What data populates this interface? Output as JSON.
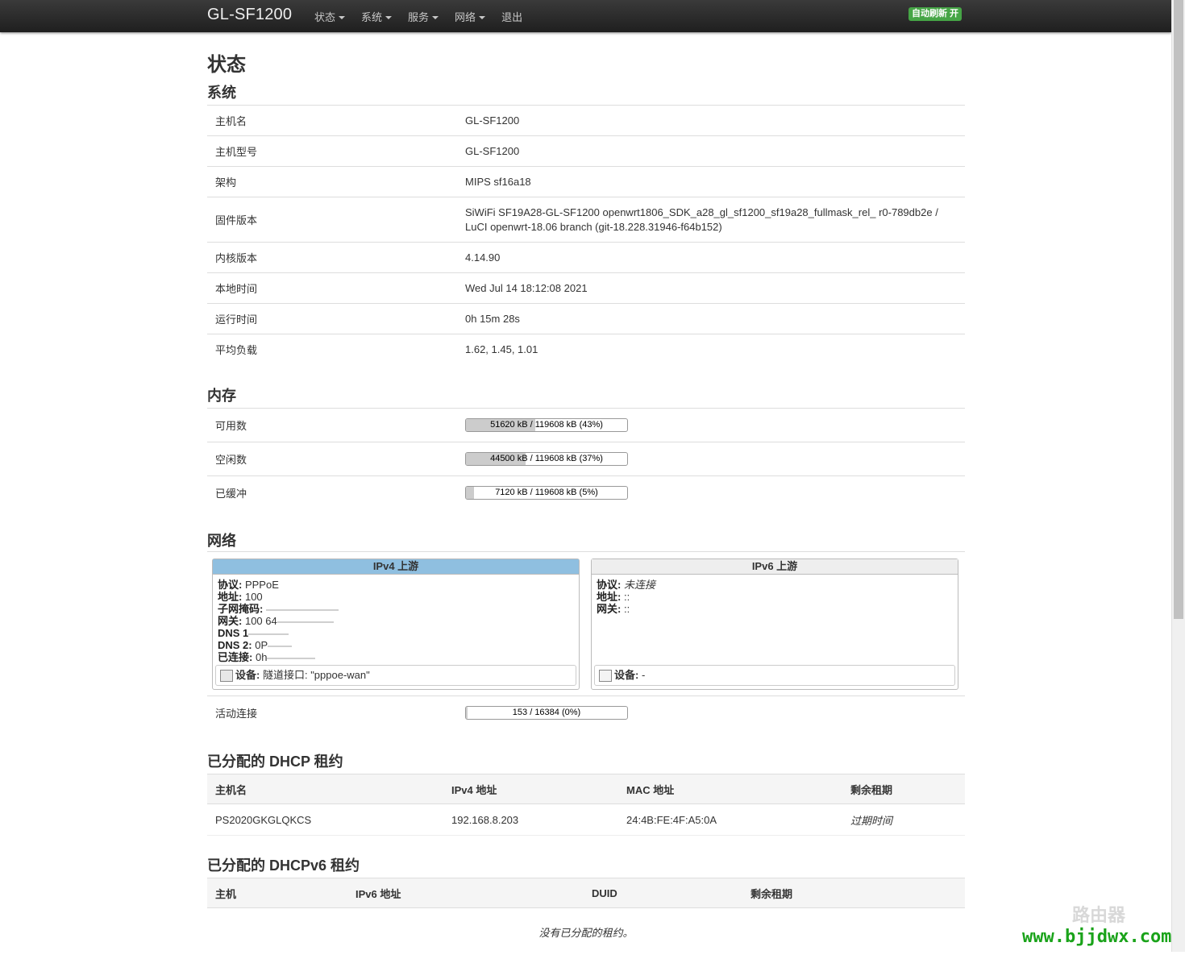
{
  "nav": {
    "brand": "GL-SF1200",
    "menu": [
      "状态",
      "系统",
      "服务",
      "网络",
      "退出"
    ],
    "autorefresh": "自动刷新 开"
  },
  "page_title": "状态",
  "system": {
    "heading": "系统",
    "rows": [
      {
        "k": "主机名",
        "v": "GL-SF1200"
      },
      {
        "k": "主机型号",
        "v": "GL-SF1200"
      },
      {
        "k": "架构",
        "v": "MIPS sf16a18"
      },
      {
        "k": "固件版本",
        "v": "SiWiFi SF19A28-GL-SF1200 openwrt1806_SDK_a28_gl_sf1200_sf19a28_fullmask_rel_ r0-789db2e /",
        "v2": "LuCI openwrt-18.06 branch (git-18.228.31946-f64b152)"
      },
      {
        "k": "内核版本",
        "v": "4.14.90"
      },
      {
        "k": "本地时间",
        "v": "Wed Jul 14 18:12:08 2021"
      },
      {
        "k": "运行时间",
        "v": "0h 15m 28s"
      },
      {
        "k": "平均负载",
        "v": "1.62, 1.45, 1.01"
      }
    ]
  },
  "memory": {
    "heading": "内存",
    "rows": [
      {
        "k": "可用数",
        "text": "51620 kB / 119608 kB (43%)",
        "pct": 43
      },
      {
        "k": "空闲数",
        "text": "44500 kB / 119608 kB (37%)",
        "pct": 37
      },
      {
        "k": "已缓冲",
        "text": "7120 kB / 119608 kB (5%)",
        "pct": 5
      }
    ]
  },
  "network": {
    "heading": "网络",
    "ipv4": {
      "title": "IPv4 上游",
      "protocol_label": "协议:",
      "protocol": "PPPoE",
      "address_label": "地址:",
      "address": "100",
      "netmask_label": "子网掩码:",
      "netmask": "",
      "gateway_label": "网关:",
      "gateway": "100 64",
      "dns1_label": "DNS 1",
      "dns1": "",
      "dns2_label": "DNS 2:",
      "dns2": "0P",
      "connected_label": "已连接:",
      "connected": "0h",
      "device_label": "设备:",
      "device": "隧道接口: \"pppoe-wan\""
    },
    "ipv6": {
      "title": "IPv6 上游",
      "protocol_label": "协议:",
      "protocol": "未连接",
      "address_label": "地址:",
      "address": "::",
      "gateway_label": "网关:",
      "gateway": "::",
      "device_label": "设备:",
      "device": "-"
    },
    "active_label": "活动连接",
    "active_text": "153 / 16384 (0%)",
    "active_pct": 0.9
  },
  "dhcp": {
    "heading": "已分配的 DHCP 租约",
    "columns": [
      "主机名",
      "IPv4 地址",
      "MAC 地址",
      "剩余租期"
    ],
    "rows": [
      {
        "host": "PS2020GKGLQKCS",
        "ip": "192.168.8.203",
        "mac": "24:4B:FE:4F:A5:0A",
        "lease": "过期时间"
      }
    ]
  },
  "dhcpv6": {
    "heading": "已分配的 DHCPv6 租约",
    "columns": [
      "主机",
      "IPv6 地址",
      "DUID",
      "剩余租期"
    ],
    "empty": "没有已分配的租约。"
  },
  "watermark": {
    "url": "www.bjjdwx.com",
    "logo": "路由器"
  }
}
